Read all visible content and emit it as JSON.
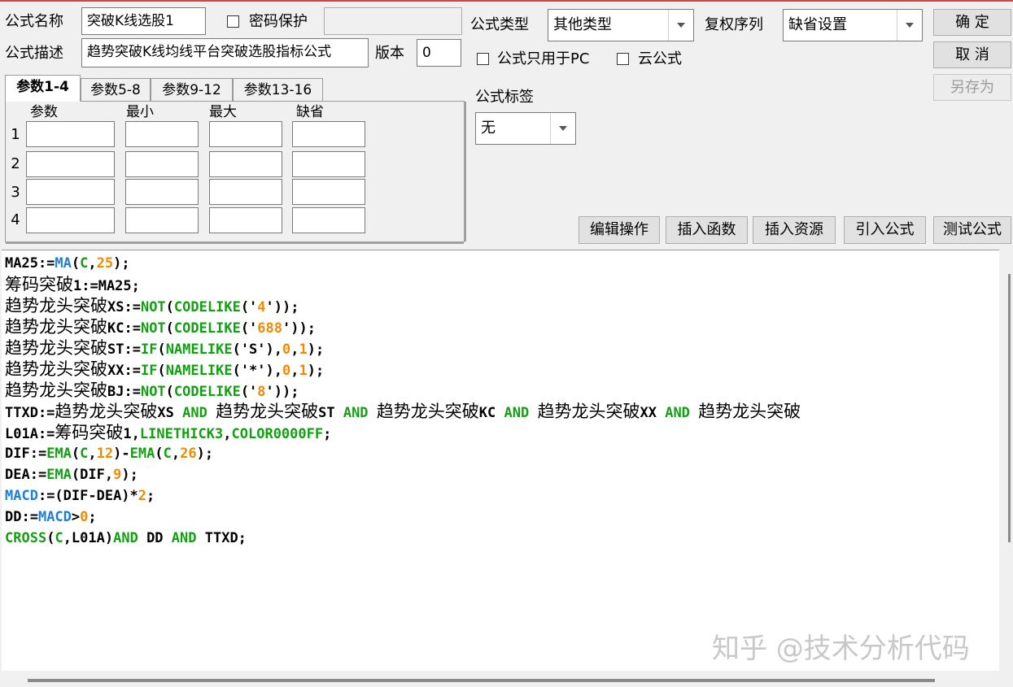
{
  "form": {
    "name_label": "公式名称",
    "name_value": "突破K线选股1",
    "password_label": "密码保护",
    "desc_label": "公式描述",
    "desc_value": "趋势突破K线均线平台突破选股指标公式",
    "version_label": "版本",
    "version_value": "0",
    "type_label": "公式类型",
    "type_value": "其他类型",
    "fq_label": "复权序列",
    "fq_value": "缺省设置",
    "pc_only_label": "公式只用于PC",
    "cloud_label": "云公式",
    "tag_label": "公式标签",
    "tag_value": "无"
  },
  "buttons": {
    "ok": "确  定",
    "cancel": "取  消",
    "save_as": "另存为",
    "edit_ops": "编辑操作",
    "insert_func": "插入函数",
    "insert_res": "插入资源",
    "import_formula": "引入公式",
    "test_formula": "测试公式"
  },
  "tabs": [
    "参数1-4",
    "参数5-8",
    "参数9-12",
    "参数13-16"
  ],
  "params": {
    "headers": [
      "参数",
      "最小",
      "最大",
      "缺省"
    ],
    "rows": [
      "1",
      "2",
      "3",
      "4"
    ]
  },
  "code": [
    [
      [
        "MA25:=",
        "p"
      ],
      [
        "MA",
        "m"
      ],
      [
        "(",
        "p"
      ],
      [
        "C",
        "f"
      ],
      [
        ",",
        "p"
      ],
      [
        "25",
        "n"
      ],
      [
        ");",
        "p"
      ]
    ],
    [
      [
        "筹码突破",
        "c"
      ],
      [
        "1:=MA25;",
        "p"
      ]
    ],
    [
      [
        "趋势龙头突破",
        "c"
      ],
      [
        "XS:=",
        "p"
      ],
      [
        "NOT",
        "f"
      ],
      [
        "(",
        "p"
      ],
      [
        "CODELIKE",
        "f"
      ],
      [
        "('",
        "p"
      ],
      [
        "4",
        "n"
      ],
      [
        "'));",
        "p"
      ]
    ],
    [
      [
        "趋势龙头突破",
        "c"
      ],
      [
        "KC:=",
        "p"
      ],
      [
        "NOT",
        "f"
      ],
      [
        "(",
        "p"
      ],
      [
        "CODELIKE",
        "f"
      ],
      [
        "('",
        "p"
      ],
      [
        "688",
        "n"
      ],
      [
        "'));",
        "p"
      ]
    ],
    [
      [
        "趋势龙头突破",
        "c"
      ],
      [
        "ST:=",
        "p"
      ],
      [
        "IF",
        "f"
      ],
      [
        "(",
        "p"
      ],
      [
        "NAMELIKE",
        "f"
      ],
      [
        "('S'),",
        "p"
      ],
      [
        "0",
        "n"
      ],
      [
        ",",
        "p"
      ],
      [
        "1",
        "n"
      ],
      [
        ");",
        "p"
      ]
    ],
    [
      [
        "趋势龙头突破",
        "c"
      ],
      [
        "XX:=",
        "p"
      ],
      [
        "IF",
        "f"
      ],
      [
        "(",
        "p"
      ],
      [
        "NAMELIKE",
        "f"
      ],
      [
        "('*'),",
        "p"
      ],
      [
        "0",
        "n"
      ],
      [
        ",",
        "p"
      ],
      [
        "1",
        "n"
      ],
      [
        ");",
        "p"
      ]
    ],
    [
      [
        "趋势龙头突破",
        "c"
      ],
      [
        "BJ:=",
        "p"
      ],
      [
        "NOT",
        "f"
      ],
      [
        "(",
        "p"
      ],
      [
        "CODELIKE",
        "f"
      ],
      [
        "('",
        "p"
      ],
      [
        "8",
        "n"
      ],
      [
        "'));",
        "p"
      ]
    ],
    [
      [
        "TTXD:=",
        "p"
      ],
      [
        "趋势龙头突破",
        "c"
      ],
      [
        "XS ",
        "p"
      ],
      [
        "AND",
        "f"
      ],
      [
        " ",
        "p"
      ],
      [
        "趋势龙头突破",
        "c"
      ],
      [
        "ST ",
        "p"
      ],
      [
        "AND",
        "f"
      ],
      [
        " ",
        "p"
      ],
      [
        "趋势龙头突破",
        "c"
      ],
      [
        "KC ",
        "p"
      ],
      [
        "AND",
        "f"
      ],
      [
        " ",
        "p"
      ],
      [
        "趋势龙头突破",
        "c"
      ],
      [
        "XX ",
        "p"
      ],
      [
        "AND",
        "f"
      ],
      [
        " ",
        "p"
      ],
      [
        "趋势龙头突破",
        "c"
      ]
    ],
    [
      [
        "L01A:=",
        "p"
      ],
      [
        "筹码突破",
        "c"
      ],
      [
        "1,",
        "p"
      ],
      [
        "LINETHICK3",
        "f"
      ],
      [
        ",",
        "p"
      ],
      [
        "COLOR0000FF",
        "f"
      ],
      [
        ";",
        "p"
      ]
    ],
    [
      [
        "DIF:=",
        "p"
      ],
      [
        "EMA",
        "f"
      ],
      [
        "(",
        "p"
      ],
      [
        "C",
        "f"
      ],
      [
        ",",
        "p"
      ],
      [
        "12",
        "n"
      ],
      [
        ")-",
        "p"
      ],
      [
        "EMA",
        "f"
      ],
      [
        "(",
        "p"
      ],
      [
        "C",
        "f"
      ],
      [
        ",",
        "p"
      ],
      [
        "26",
        "n"
      ],
      [
        ");",
        "p"
      ]
    ],
    [
      [
        "DEA:=",
        "p"
      ],
      [
        "EMA",
        "f"
      ],
      [
        "(DIF,",
        "p"
      ],
      [
        "9",
        "n"
      ],
      [
        ");",
        "p"
      ]
    ],
    [
      [
        "MACD",
        "m"
      ],
      [
        ":=(DIF-DEA)*",
        "p"
      ],
      [
        "2",
        "n"
      ],
      [
        ";",
        "p"
      ]
    ],
    [
      [
        "DD:=",
        "p"
      ],
      [
        "MACD",
        "m"
      ],
      [
        ">",
        "p"
      ],
      [
        "0",
        "n"
      ],
      [
        ";",
        "p"
      ]
    ],
    [
      [
        "CROSS",
        "f"
      ],
      [
        "(",
        "p"
      ],
      [
        "C",
        "f"
      ],
      [
        ",L01A)",
        "p"
      ],
      [
        "AND",
        "f"
      ],
      [
        " DD ",
        "p"
      ],
      [
        "AND",
        "f"
      ],
      [
        " TTXD;",
        "p"
      ]
    ]
  ],
  "watermark": "知乎 @技术分析代码"
}
